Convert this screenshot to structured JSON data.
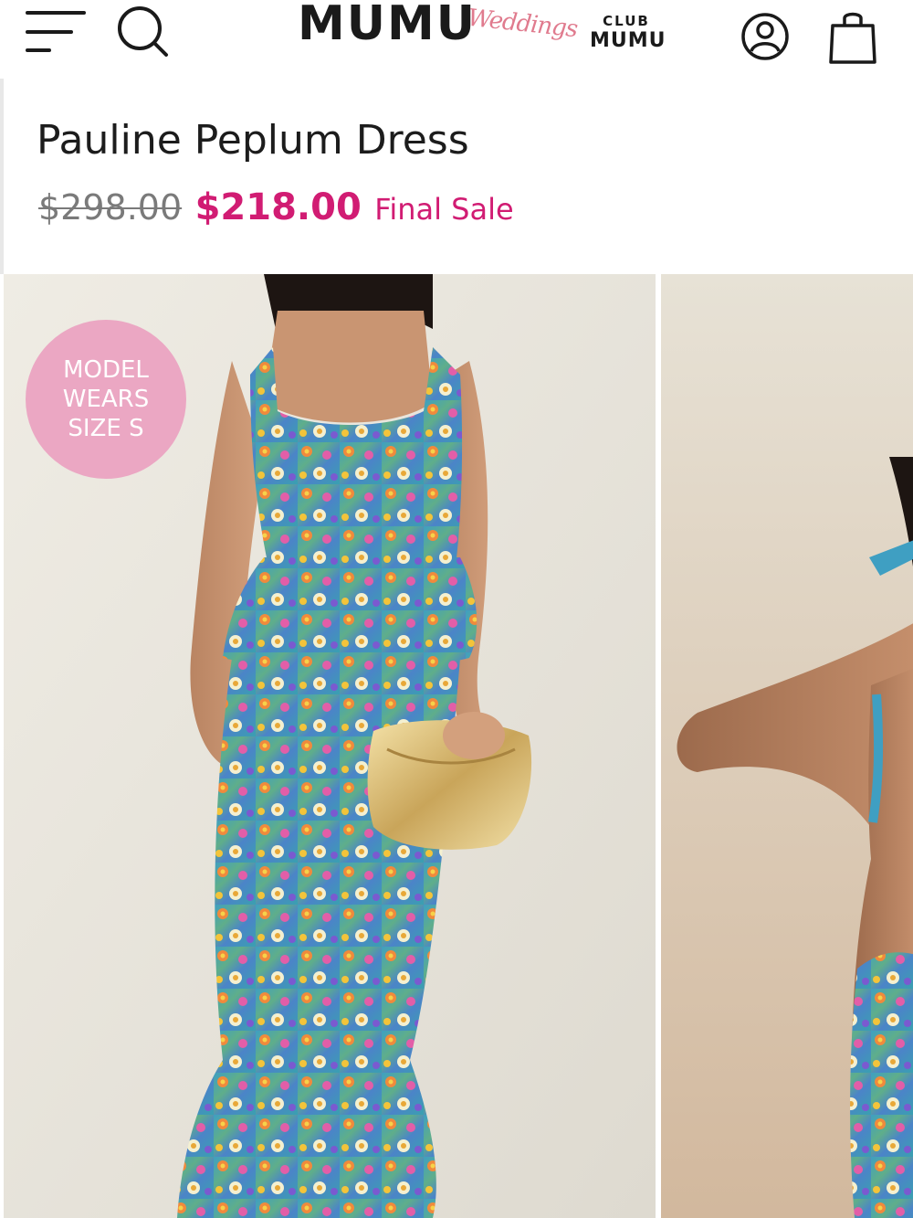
{
  "header": {
    "menu_icon": "hamburger-menu-icon",
    "search_icon": "search-icon",
    "logo": {
      "brand": "MUMU",
      "script": "Weddings"
    },
    "club": {
      "top": "CLUB",
      "bottom": "MUMU"
    },
    "account_icon": "account-icon",
    "bag_icon": "shopping-bag-icon"
  },
  "product": {
    "title": "Pauline Peplum Dress",
    "price_original": "$298.00",
    "price_sale": "$218.00",
    "sale_note": "Final Sale"
  },
  "gallery": {
    "badge": {
      "line1": "MODEL",
      "line2": "WEARS",
      "line3": "SIZE S"
    }
  },
  "colors": {
    "sale": "#d11c73",
    "badge": "#eba7c3",
    "logo_script": "#e07b8e",
    "text": "#1c1c1c"
  }
}
